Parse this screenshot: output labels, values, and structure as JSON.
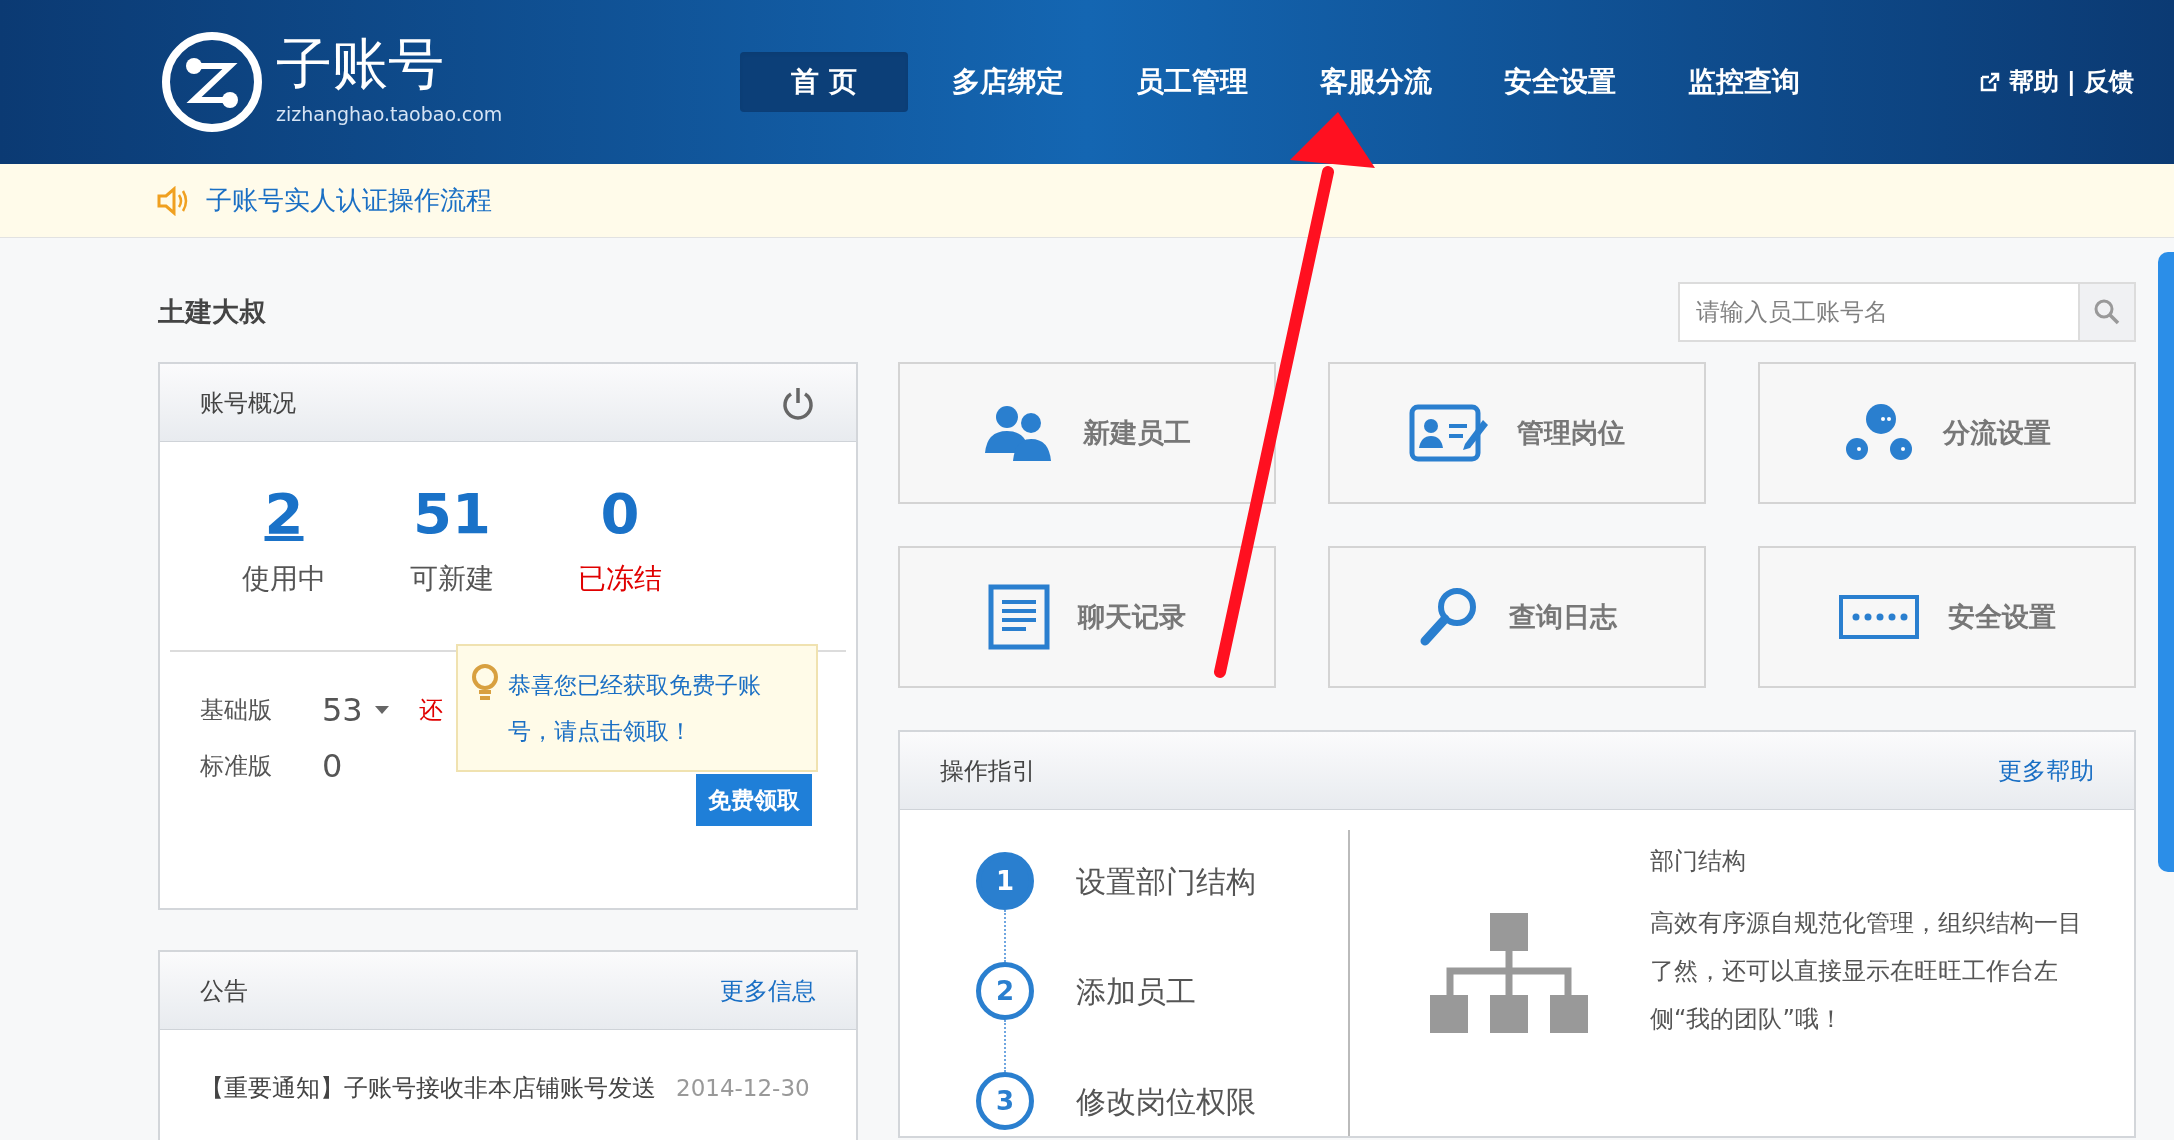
{
  "logo": {
    "title": "子账号",
    "subtitle": "zizhanghao.taobao.com"
  },
  "nav": [
    {
      "label": "首 页",
      "selected": true
    },
    {
      "label": "多店绑定",
      "selected": false
    },
    {
      "label": "员工管理",
      "selected": false
    },
    {
      "label": "客服分流",
      "selected": false
    },
    {
      "label": "安全设置",
      "selected": false
    },
    {
      "label": "监控查询",
      "selected": false
    }
  ],
  "header_links": {
    "help": "帮助",
    "separator": "|",
    "feedback": "反馈"
  },
  "notice": "子账号实人认证操作流程",
  "user_name": "土建大叔",
  "search": {
    "placeholder": "请输入员工账号名"
  },
  "account_panel": {
    "title": "账号概况",
    "stats": [
      {
        "value": "2",
        "label": "使用中",
        "kind": "link"
      },
      {
        "value": "51",
        "label": "可新建",
        "kind": "plain"
      },
      {
        "value": "0",
        "label": "已冻结",
        "kind": "frozen"
      }
    ],
    "versions": [
      {
        "name": "基础版",
        "count": "53",
        "dropdown": true
      },
      {
        "name": "标准版",
        "count": "0",
        "dropdown": false
      }
    ],
    "extra": "还",
    "tooltip": "恭喜您已经获取免费子账号，请点击领取！",
    "button": "免费领取"
  },
  "announcement_panel": {
    "title": "公告",
    "more": "更多信息",
    "items": [
      {
        "title": "【重要通知】子账号接收非本店铺账号发送",
        "date": "2014-12-30"
      }
    ]
  },
  "tiles": [
    {
      "label": "新建员工",
      "kind": "people"
    },
    {
      "label": "管理岗位",
      "kind": "card"
    },
    {
      "label": "分流设置",
      "kind": "bubbles"
    },
    {
      "label": "聊天记录",
      "kind": "document"
    },
    {
      "label": "查询日志",
      "kind": "magnifier"
    },
    {
      "label": "安全设置",
      "kind": "password"
    }
  ],
  "guide_panel": {
    "title": "操作指引",
    "more": "更多帮助",
    "steps": [
      {
        "number": "1",
        "label": "设置部门结构",
        "selected": true
      },
      {
        "number": "2",
        "label": "添加员工",
        "selected": false
      },
      {
        "number": "3",
        "label": "修改岗位权限",
        "selected": false
      }
    ],
    "detail": {
      "title": "部门结构",
      "text": "高效有序源自规范化管理，组织结构一目了然，还可以直接显示在旺旺工作台左侧“我的团队”哦！"
    }
  }
}
